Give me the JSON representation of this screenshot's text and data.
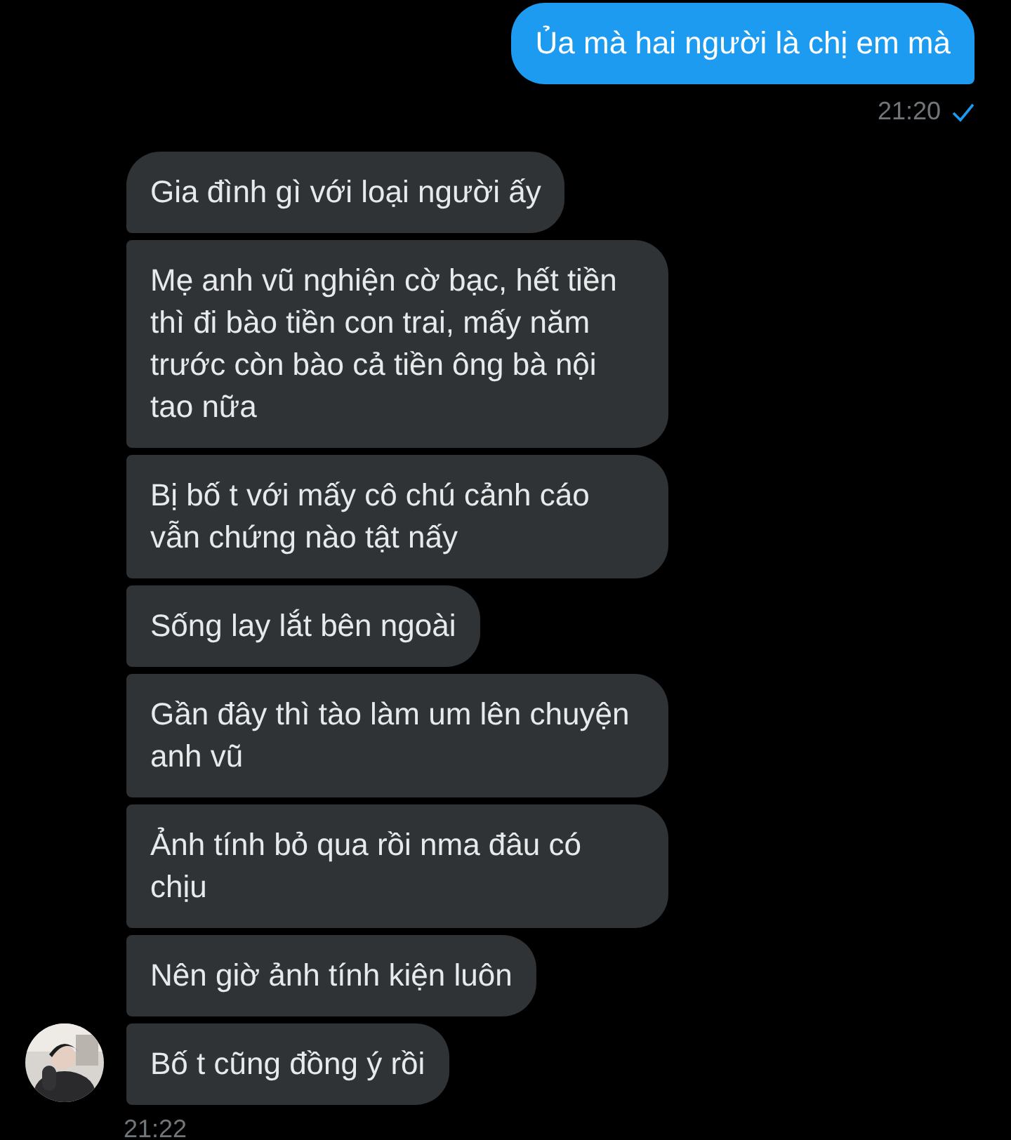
{
  "groups": [
    {
      "kind": "outgoing",
      "messages": [
        "Ủa mà hai người là chị em mà"
      ],
      "time": "21:20",
      "seen": true,
      "avatar": false
    },
    {
      "kind": "incoming",
      "messages": [
        "Gia đình gì với loại người ấy",
        "Mẹ anh vũ nghiện cờ bạc, hết tiền thì đi bào tiền con trai, mấy năm trước còn bào cả tiền ông bà nội tao nữa",
        "Bị bố t với mấy cô chú cảnh cáo vẫn chứng nào tật nấy",
        "Sống lay lắt bên ngoài",
        "Gần đây thì tào làm um lên chuyện anh vũ",
        "Ảnh tính bỏ qua rồi nma đâu có chịu",
        "Nên giờ ảnh tính kiện luôn",
        "Bố t cũng đồng ý rồi"
      ],
      "time": "21:22",
      "seen": false,
      "avatar": true
    }
  ]
}
